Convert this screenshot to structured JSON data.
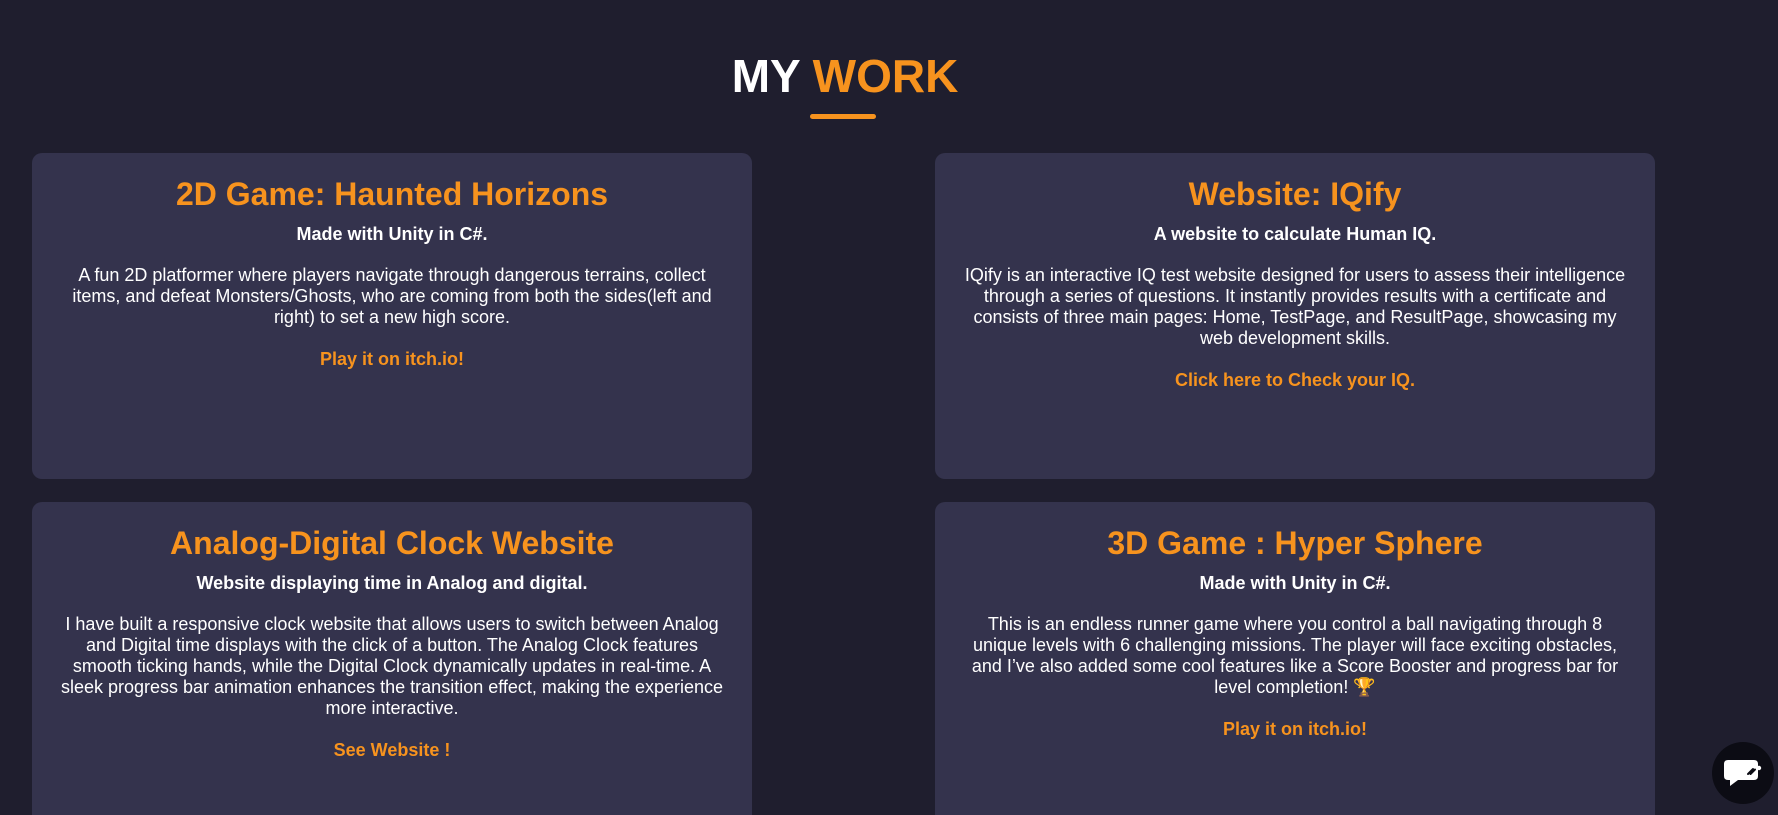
{
  "section": {
    "title_prefix": "MY",
    "title_accent": "WORK"
  },
  "cards": [
    {
      "title": "2D Game: Haunted Horizons",
      "subtitle": "Made with Unity in C#.",
      "description": "A fun 2D platformer where players navigate through dangerous terrains, collect items, and defeat Monsters/Ghosts, who are coming from both the sides(left and right) to set a new high score.",
      "link": "Play it on itch.io!"
    },
    {
      "title": "Website: IQify",
      "subtitle": "A website to calculate Human IQ.",
      "description": "IQify is an interactive IQ test website designed for users to assess their intelligence through a series of questions. It instantly provides results with a certificate and consists of three main pages: Home, TestPage, and ResultPage, showcasing my web development skills.",
      "link": "Click here to Check your IQ."
    },
    {
      "title": "Analog-Digital Clock Website",
      "subtitle": "Website displaying time in Analog and digital.",
      "description": "I have built a responsive clock website that allows users to switch between Analog and Digital time displays with the click of a button. The Analog Clock features smooth ticking hands, while the Digital Clock dynamically updates in real-time. A sleek progress bar animation enhances the transition effect, making the experience more interactive.",
      "link": "See Website !"
    },
    {
      "title": "3D Game : Hyper Sphere",
      "subtitle": "Made with Unity in C#.",
      "description": "This is an endless runner game where you control a ball navigating through 8 unique levels with 6 challenging missions. The player will face exciting obstacles, and I’ve also added some cool features like a Score Booster and progress bar for level completion! 🏆",
      "link": "Play it on itch.io!"
    }
  ],
  "icons": {
    "chat": "chat-bubble-icon"
  },
  "colors": {
    "background": "#1f1e2e",
    "card": "#34334d",
    "accent": "#f7931e"
  }
}
